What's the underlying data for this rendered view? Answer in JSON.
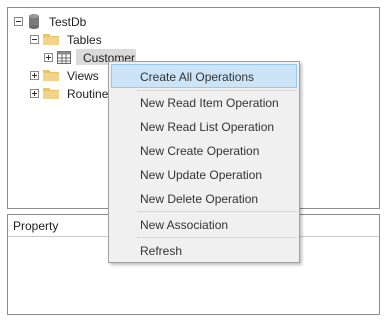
{
  "tree": {
    "root": {
      "label": "TestDb",
      "icon": "database-icon",
      "expanded": true
    },
    "tables": {
      "label": "Tables",
      "icon": "folder-icon",
      "expanded": true
    },
    "customer": {
      "label": "Customer",
      "icon": "table-icon",
      "expanded": false,
      "selected": true
    },
    "views": {
      "label": "Views",
      "icon": "folder-icon",
      "expanded": false
    },
    "routines": {
      "label": "Routine",
      "icon": "folder-icon",
      "expanded": false
    }
  },
  "property_panel": {
    "header": "Property"
  },
  "context_menu": {
    "items": [
      {
        "label": "Create All Operations",
        "highlighted": true
      },
      {
        "label": "New Read Item Operation"
      },
      {
        "label": "New Read List Operation"
      },
      {
        "label": "New Create Operation"
      },
      {
        "label": "New Update Operation"
      },
      {
        "label": "New Delete Operation"
      },
      {
        "label": "New Association"
      },
      {
        "label": "Refresh"
      }
    ]
  },
  "colors": {
    "folder": "#e8c36a",
    "highlight": "#cce4f7",
    "menu_bg": "#f0f0f0",
    "selection": "#dadada"
  }
}
